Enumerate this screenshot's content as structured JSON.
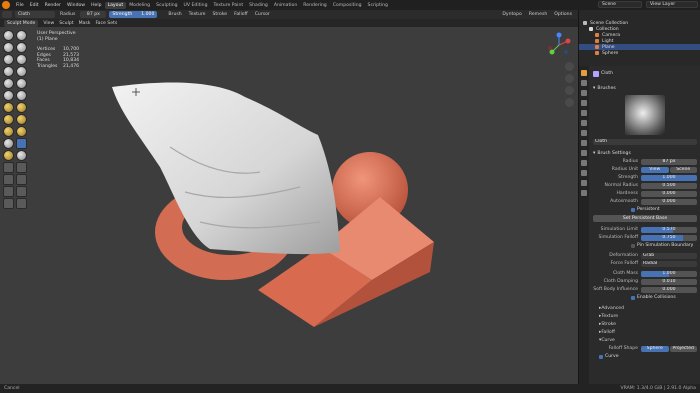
{
  "topbar": {
    "menus": [
      "File",
      "Edit",
      "Render",
      "Window",
      "Help"
    ],
    "workspaces": [
      "Layout",
      "Modeling",
      "Sculpting",
      "UV Editing",
      "Texture Paint",
      "Shading",
      "Animation",
      "Rendering",
      "Compositing",
      "Scripting"
    ],
    "active_workspace": "Layout",
    "scene_label": "Scene",
    "view_layer_label": "View Layer"
  },
  "header": {
    "object_name": "Cloth",
    "radius_label": "Radius",
    "radius_value": "87 px",
    "strength_label": "Strength",
    "strength_value": "1.000",
    "dropdowns": [
      "Brush",
      "Texture",
      "Stroke",
      "Falloff",
      "Cursor"
    ],
    "right_items": [
      "Dyntopo",
      "Remesh",
      "Options"
    ]
  },
  "viewport_header": {
    "mode": "Sculpt Mode",
    "menus": [
      "View",
      "Sculpt",
      "Mask",
      "Face Sets"
    ]
  },
  "overlay": {
    "view_name": "User Perspective",
    "object": "(1) Plane"
  },
  "stats": [
    {
      "key": "Vertices",
      "value": "10,700"
    },
    {
      "key": "Edges",
      "value": "21,573"
    },
    {
      "key": "Faces",
      "value": "10,834"
    },
    {
      "key": "Triangles",
      "value": "21,476"
    }
  ],
  "outliner": {
    "title": "Scene Collection",
    "items": [
      {
        "label": "Collection",
        "color": "#dddddd"
      },
      {
        "label": "Camera",
        "color": "#e08040"
      },
      {
        "label": "Light",
        "color": "#e08040"
      },
      {
        "label": "Plane",
        "color": "#e08040",
        "selected": true
      },
      {
        "label": "Sphere",
        "color": "#e08040"
      }
    ]
  },
  "properties": {
    "brush_name": "Cloth",
    "brushes_label": "Brushes",
    "brush_field": "Cloth",
    "brush_settings_label": "Brush Settings",
    "fields": [
      {
        "label": "Radius",
        "value": "87 px",
        "fill": 0
      },
      {
        "label": "Radius Unit",
        "value": "View",
        "alt": "Scene"
      },
      {
        "label": "Strength",
        "value": "1.000",
        "fill": 1
      },
      {
        "label": "Normal Radius",
        "value": "0.500",
        "fill": 0
      },
      {
        "label": "Hardness",
        "value": "0.000",
        "fill": 0
      },
      {
        "label": "Autosmooth",
        "value": "0.000",
        "fill": 0
      }
    ],
    "persistent_label": "Persistent",
    "set_persistent_label": "Set Persistent Base",
    "sim_fields": [
      {
        "label": "Simulation Limit",
        "value": "0.570",
        "fill": 0.57
      },
      {
        "label": "Simulation Falloff",
        "value": "0.750",
        "fill": 0.75
      }
    ],
    "pin_boundary_label": "Pin Simulation Boundary",
    "deformation_label": "Deformation",
    "deformation_value": "Grab",
    "force_falloff_label": "Force Falloff",
    "force_falloff_value": "Radial",
    "cloth_fields": [
      {
        "label": "Cloth Mass",
        "value": "1.000",
        "fill": 0.5
      },
      {
        "label": "Cloth Damping",
        "value": "0.010",
        "fill": 0
      },
      {
        "label": "Soft Body Influence",
        "value": "0.000",
        "fill": 0
      }
    ],
    "collisions_label": "Enable Collisions",
    "subpanels": [
      "Advanced",
      "Texture",
      "Stroke",
      "Falloff"
    ],
    "curve_label": "Curve",
    "falloff_shape_label": "Falloff Shape",
    "falloff_shape_options": [
      "Sphere",
      "Projected"
    ],
    "curve_checkbox": "Curve"
  },
  "statusbar": {
    "left": "Cancel",
    "right": "VRAM: 1.3/4.0 GiB | 2.91.0 Alpha"
  },
  "colors": {
    "accent": "#4772b3",
    "object": "#e07a5f",
    "cloth": "#e6e6e6"
  }
}
